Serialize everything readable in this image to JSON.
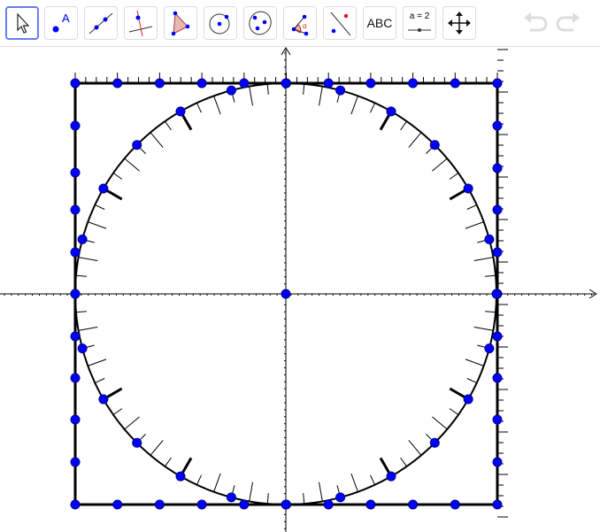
{
  "toolbar": {
    "tools": [
      {
        "icon": "move-arrow-icon",
        "active": true
      },
      {
        "icon": "point-icon",
        "label": "A"
      },
      {
        "icon": "line-icon"
      },
      {
        "icon": "perpendicular-line-icon"
      },
      {
        "icon": "polygon-icon"
      },
      {
        "icon": "circle-center-point-icon"
      },
      {
        "icon": "conic-five-points-icon"
      },
      {
        "icon": "angle-icon",
        "label": "α"
      },
      {
        "icon": "reflect-about-line-icon"
      },
      {
        "icon": "text-icon",
        "label": "ABC"
      },
      {
        "icon": "slider-icon",
        "label": "a = 2"
      },
      {
        "icon": "move-graphics-view-icon"
      }
    ],
    "undo_icon": "undo-icon",
    "redo_icon": "redo-icon"
  },
  "colors": {
    "point": "#0000ff",
    "accent": "#6b7cf7",
    "polygon_fill": "#e8b8b0",
    "red": "#e02020"
  }
}
